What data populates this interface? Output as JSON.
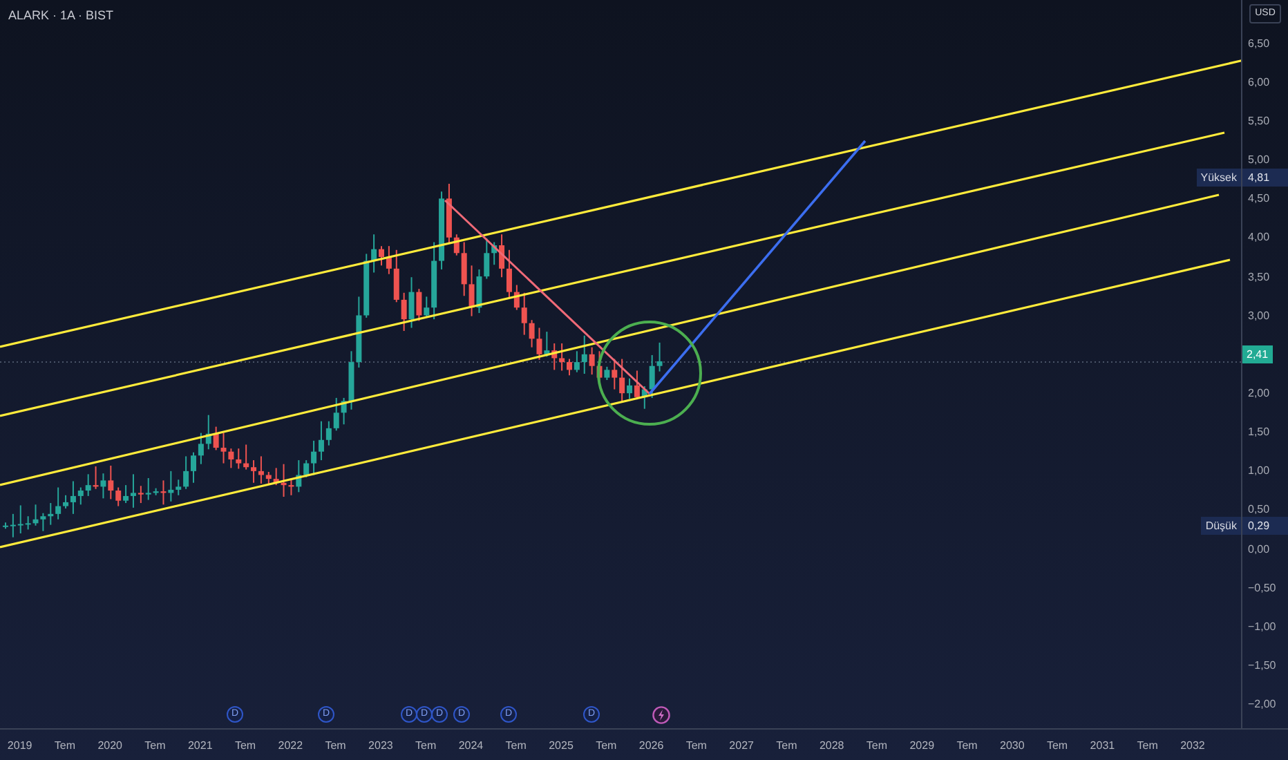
{
  "chart": {
    "symbol": "ALARK · 1A · BIST"
  },
  "price_scale": {
    "currency": "USD",
    "ticks": [
      {
        "kind": "tick",
        "label": "6,50"
      },
      {
        "kind": "tick",
        "label": "6,00"
      },
      {
        "kind": "tick",
        "label": "5,50"
      },
      {
        "kind": "tick",
        "label": "5,00"
      },
      {
        "kind": "tick",
        "label": "4,50"
      },
      {
        "kind": "tick",
        "label": "4,00"
      },
      {
        "kind": "tick",
        "label": "3,50"
      },
      {
        "kind": "tick",
        "label": "3,00"
      },
      {
        "kind": "current",
        "label": "2,41"
      },
      {
        "kind": "tick",
        "label": "2,00"
      },
      {
        "kind": "tick",
        "label": "1,50"
      },
      {
        "kind": "tick",
        "label": "1,00"
      },
      {
        "kind": "tick",
        "label": "0,50"
      },
      {
        "kind": "tick",
        "label": "0,00"
      },
      {
        "kind": "tick",
        "label": "−0,50"
      },
      {
        "kind": "tick",
        "label": "−1,00"
      },
      {
        "kind": "tick",
        "label": "−1,50"
      },
      {
        "kind": "tick",
        "label": "−2,00"
      }
    ],
    "high": {
      "label": "Yüksek",
      "value": "4,81"
    },
    "low": {
      "label": "Düşük",
      "value": "0,29"
    }
  },
  "time_scale": {
    "labels": [
      "2019",
      "Tem",
      "2020",
      "Tem",
      "2021",
      "Tem",
      "2022",
      "Tem",
      "2023",
      "Tem",
      "2024",
      "Tem",
      "2025",
      "Tem",
      "2026",
      "Tem",
      "2027",
      "Tem",
      "2028",
      "Tem",
      "2029",
      "Tem",
      "2030",
      "Tem",
      "2031",
      "Tem",
      "2032"
    ]
  },
  "events": [
    {
      "kind": "dividend",
      "label": "D"
    },
    {
      "kind": "dividend",
      "label": "D"
    },
    {
      "kind": "dividend",
      "label": "D"
    },
    {
      "kind": "dividend",
      "label": "D"
    },
    {
      "kind": "dividend",
      "label": "D"
    },
    {
      "kind": "dividend",
      "label": "D"
    },
    {
      "kind": "dividend",
      "label": "D"
    },
    {
      "kind": "dividend",
      "label": "D"
    },
    {
      "kind": "earnings"
    }
  ]
}
